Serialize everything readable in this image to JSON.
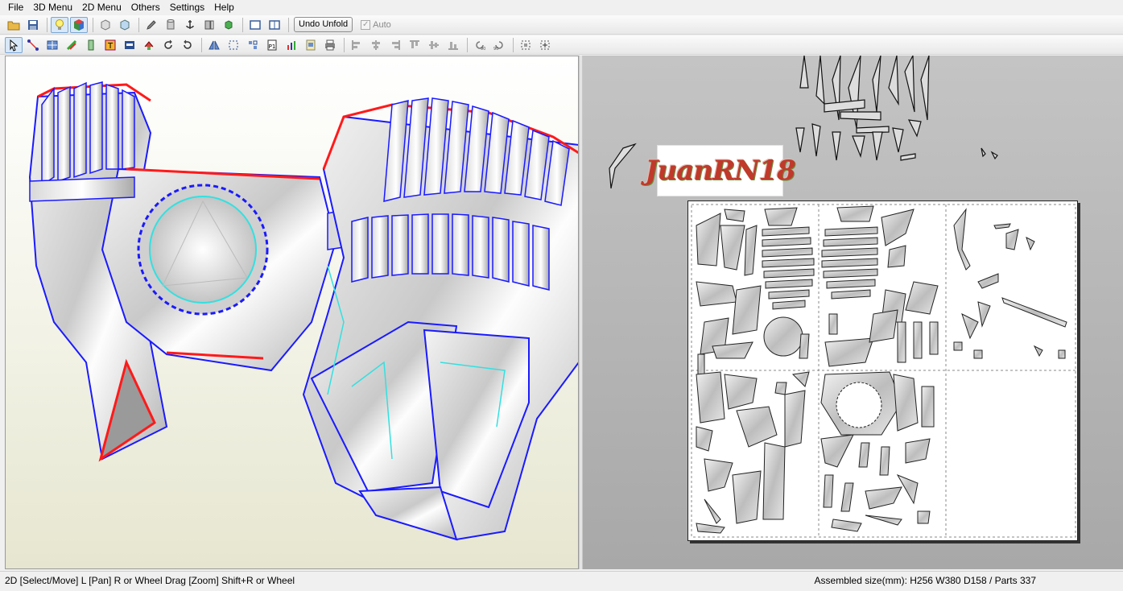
{
  "menu": {
    "items": [
      "File",
      "3D Menu",
      "2D Menu",
      "Others",
      "Settings",
      "Help"
    ]
  },
  "toolbar1": {
    "undo_unfold_label": "Undo Unfold",
    "auto_label": "Auto",
    "auto_checked": true
  },
  "viewport2d": {
    "watermark_text": "JuanRN18"
  },
  "status": {
    "left": "2D [Select/Move] L [Pan] R or Wheel Drag [Zoom] Shift+R or Wheel",
    "right": "Assembled size(mm): H256 W380 D158 / Parts 337"
  },
  "colors": {
    "edge_blue": "#1a1aff",
    "cut_red": "#ff1a1a",
    "fold_cyan": "#33e0e0",
    "watermark_red": "#c0392b"
  },
  "icons": {
    "toolbar1": [
      "open-folder-icon",
      "save-icon",
      "lightbulb-icon",
      "color-cube-icon",
      "box-icon",
      "texture-box-icon",
      "pencil-icon",
      "cylinder-icon",
      "anchor-icon",
      "split-icon",
      "green-cube-icon",
      "single-view-icon",
      "dual-view-icon"
    ],
    "toolbar2": [
      "select-arrow-icon",
      "edge-tool-icon",
      "grid-icon",
      "color-icon",
      "piece-icon",
      "text-icon",
      "image-icon",
      "move-piece-icon",
      "rotate-left-icon",
      "rotate-right-icon",
      "flip-icon",
      "join-icon",
      "fit-icon",
      "page-one-icon",
      "chart-icon",
      "page-settings-icon",
      "print-icon",
      "align-left-icon",
      "align-center-icon",
      "align-right-icon",
      "align-top-icon",
      "align-middle-icon",
      "align-bottom-icon",
      "rotate-90-ccw-icon",
      "rotate-90-cw-icon",
      "frame-icon",
      "frame-move-icon"
    ]
  }
}
